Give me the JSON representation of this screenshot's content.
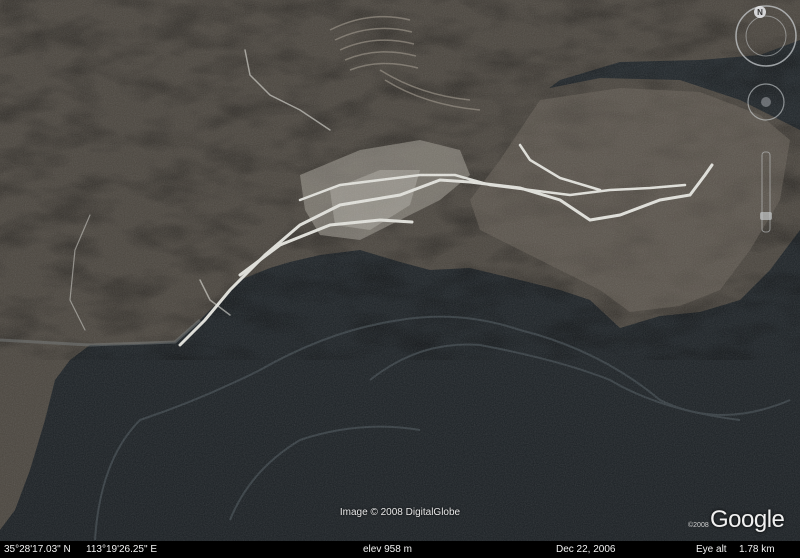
{
  "credit": "Image © 2008 DigitalGlobe",
  "logo": {
    "year": "©2008",
    "wordmark": "Google"
  },
  "status": {
    "lat": "35°28'17.03\" N",
    "lon": "113°19'26.25\" E",
    "elev": "elev  958 m",
    "date": "Dec 22, 2006",
    "eye_label": "Eye alt",
    "eye_value": "1.78 km"
  },
  "navigation": {
    "compass_north": "N"
  },
  "colors": {
    "water": "#1e2326",
    "land": "#4a4640",
    "road": "#e2e2dc",
    "status_bar": "#000000"
  }
}
